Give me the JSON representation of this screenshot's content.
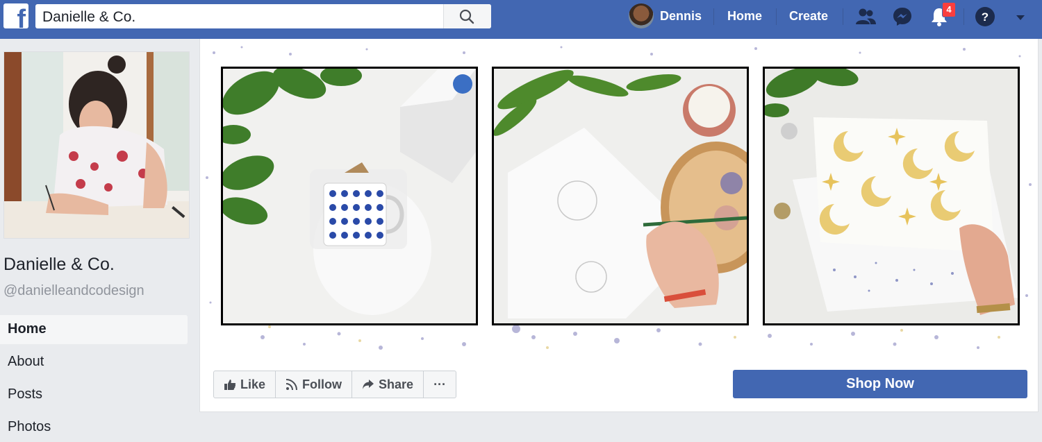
{
  "topbar": {
    "search_value": "Danielle & Co.",
    "user_name": "Dennis",
    "home_label": "Home",
    "create_label": "Create",
    "notifications_count": "4",
    "brand_color": "#4267b2"
  },
  "page": {
    "name": "Danielle & Co.",
    "handle": "@danielleandcodesign"
  },
  "left_nav": {
    "items": [
      {
        "label": "Home"
      },
      {
        "label": "About"
      },
      {
        "label": "Posts"
      },
      {
        "label": "Photos"
      }
    ]
  },
  "actions": {
    "like_label": "Like",
    "follow_label": "Follow",
    "share_label": "Share",
    "more_label": "···",
    "shop_label": "Shop Now"
  },
  "icons": {
    "logo": "facebook-logo-icon",
    "search": "search-icon",
    "friends": "friends-icon",
    "messenger": "messenger-icon",
    "notifications": "bell-icon",
    "help": "help-icon",
    "menu": "caret-down-icon"
  }
}
